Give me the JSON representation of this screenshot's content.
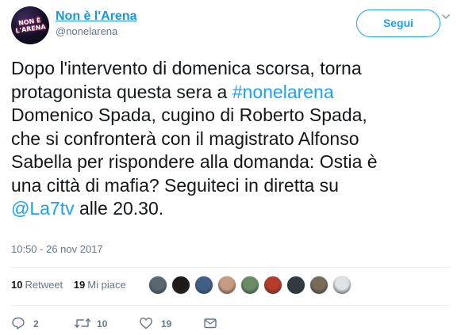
{
  "user": {
    "display_name": "Non è l'Arena",
    "screen_name": "@nonelarena",
    "avatar_text": "NON È L'ARENA"
  },
  "follow_button": {
    "label": "Segui"
  },
  "tweet": {
    "lines": [
      [
        {
          "text": "Dopo l'intervento di domenica scorsa, torna"
        }
      ],
      [
        {
          "text": "protagonista questa sera a "
        },
        {
          "text": "#nonelarena",
          "link": true
        }
      ],
      [
        {
          "text": "Domenico Spada, cugino di Roberto Spada,"
        }
      ],
      [
        {
          "text": "che si confronterà con il magistrato Alfonso"
        }
      ],
      [
        {
          "text": "Sabella per rispondere alla domanda: Ostia è"
        }
      ],
      [
        {
          "text": "una città di mafia? Seguiteci in diretta su"
        }
      ],
      [
        {
          "text": "@La7tv",
          "link": true
        },
        {
          "text": " alle 20.30."
        }
      ]
    ],
    "timestamp": "10:50 - 26 nov 2017"
  },
  "stats": {
    "retweets": {
      "count": "10",
      "label": "Retweet"
    },
    "likes": {
      "count": "19",
      "label": "Mi piace"
    }
  },
  "likers": [
    {
      "name": "liker-1",
      "color": "#5b6770"
    },
    {
      "name": "liker-2",
      "color": "#1f1a18"
    },
    {
      "name": "liker-3",
      "color": "#3f5f86"
    },
    {
      "name": "liker-4",
      "color": "#c89a80"
    },
    {
      "name": "liker-5",
      "color": "#6b8a66"
    },
    {
      "name": "liker-6",
      "color": "#b63b2a"
    },
    {
      "name": "liker-7",
      "color": "#333a40"
    },
    {
      "name": "liker-8",
      "color": "#7a6a58"
    },
    {
      "name": "liker-9",
      "color": "#dfe3e6"
    }
  ],
  "actions": {
    "reply": {
      "count": "2",
      "icon": "reply-icon"
    },
    "retweet": {
      "count": "10",
      "icon": "retweet-icon"
    },
    "like": {
      "count": "19",
      "icon": "heart-icon"
    },
    "message": {
      "icon": "envelope-icon"
    }
  }
}
